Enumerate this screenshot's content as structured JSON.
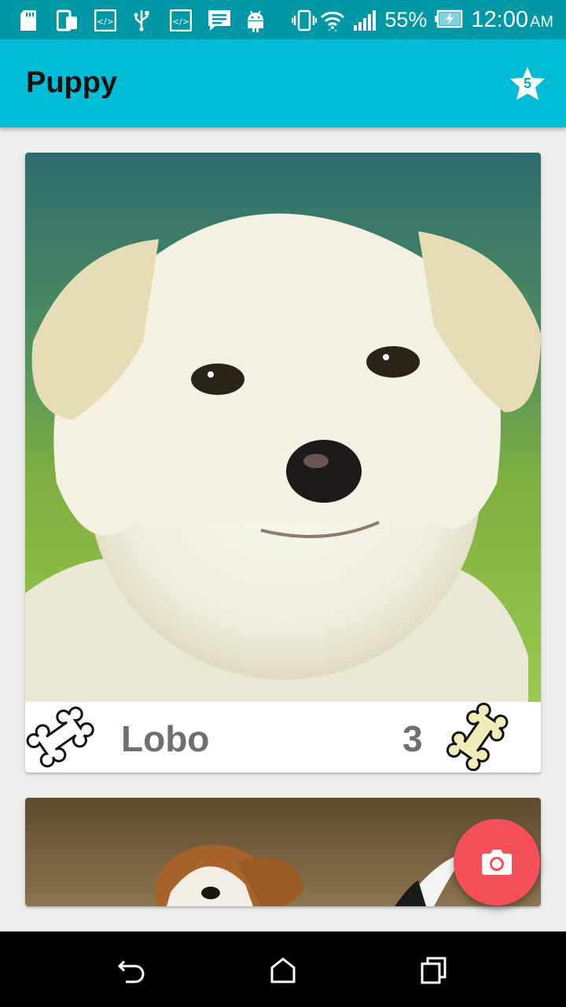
{
  "status_bar": {
    "battery_percent": "55%",
    "time": "12:00",
    "ampm": "AM",
    "icons_left": [
      "sd-card-icon",
      "devices-icon",
      "code-icon",
      "usb-icon",
      "code-icon",
      "message-icon",
      "android-icon"
    ],
    "icons_right": [
      "vibrate-icon",
      "wifi-icon",
      "signal-icon",
      "battery-charging-icon"
    ]
  },
  "app_bar": {
    "title": "Puppy",
    "favorites_count": "5"
  },
  "cards": [
    {
      "name": "Lobo",
      "likes": "3",
      "like_icon": "bone-outline-icon",
      "rating_icon": "bone-filled-icon"
    }
  ],
  "fab": {
    "icon": "camera-icon"
  },
  "nav_bar": {
    "buttons": [
      "back-icon",
      "home-icon",
      "recents-icon"
    ]
  },
  "colors": {
    "status_bar": "#0097a7",
    "app_bar": "#00bcd4",
    "fab": "#f4505a",
    "background": "#ededed",
    "text_muted": "#6f6f6f"
  }
}
